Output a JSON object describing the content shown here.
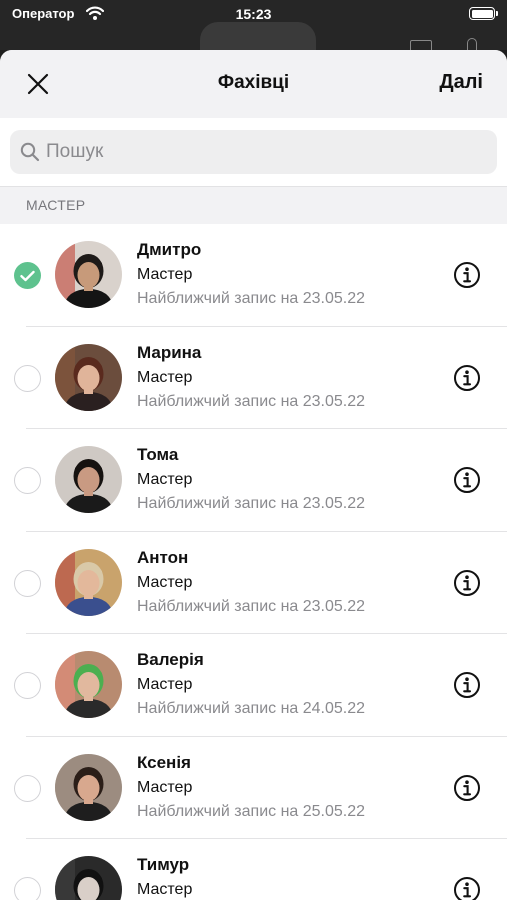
{
  "status_bar": {
    "carrier": "Оператор",
    "time": "15:23"
  },
  "nav": {
    "title": "Фахівці",
    "next_label": "Далі"
  },
  "search": {
    "placeholder": "Пошук",
    "value": ""
  },
  "section": {
    "title": "МАСТЕР"
  },
  "specialists": [
    {
      "name": "Дмитро",
      "role": "Мастер",
      "next_slot": "Найближчий запис на 23.05.22",
      "selected": true,
      "avatar": {
        "bg": "#d9d2cc",
        "skin": "#c79a7a",
        "hair": "#1e1a18",
        "shirt": "#141414",
        "accent": "#c0392b"
      }
    },
    {
      "name": "Марина",
      "role": "Мастер",
      "next_slot": "Найближчий запис на 23.05.22",
      "selected": false,
      "avatar": {
        "bg": "#6b4d3d",
        "skin": "#e0b49a",
        "hair": "#5a2a1e",
        "shirt": "#2a2020",
        "accent": "#8b5a3c"
      }
    },
    {
      "name": "Тома",
      "role": "Мастер",
      "next_slot": "Найближчий запис на 23.05.22",
      "selected": false,
      "avatar": {
        "bg": "#cfc9c4",
        "skin": "#c99a82",
        "hair": "#161210",
        "shirt": "#1a1a1a",
        "accent": "#cfc9c4"
      }
    },
    {
      "name": "Антон",
      "role": "Мастер",
      "next_slot": "Найближчий запис на 23.05.22",
      "selected": false,
      "avatar": {
        "bg": "#c9a36c",
        "skin": "#e3b89b",
        "hair": "#d9c9a8",
        "shirt": "#3a4f8e",
        "accent": "#b33a3a"
      }
    },
    {
      "name": "Валерія",
      "role": "Мастер",
      "next_slot": "Найближчий запис на 24.05.22",
      "selected": false,
      "avatar": {
        "bg": "#b88b70",
        "skin": "#e1b89e",
        "hair": "#4caf50",
        "shirt": "#2a2a2a",
        "accent": "#e98c7c"
      }
    },
    {
      "name": "Ксенія",
      "role": "Мастер",
      "next_slot": "Найближчий запис на 25.05.22",
      "selected": false,
      "avatar": {
        "bg": "#9c8c80",
        "skin": "#d8a88e",
        "hair": "#2b1e18",
        "shirt": "#1e1e1e",
        "accent": "#9c8c80"
      }
    },
    {
      "name": "Тимур",
      "role": "Мастер",
      "next_slot": "",
      "selected": false,
      "avatar": {
        "bg": "#2a2a2a",
        "skin": "#d9cfc8",
        "hair": "#111111",
        "shirt": "#0f0f0f",
        "accent": "#444444"
      }
    }
  ],
  "icons": {
    "close": "close-icon",
    "search": "search-icon",
    "info": "info-icon",
    "check": "checkmark-icon"
  },
  "colors": {
    "check_green": "#5ec28e",
    "nav_bg": "#f2f2f4",
    "secondary_text": "#8a8a8e"
  }
}
